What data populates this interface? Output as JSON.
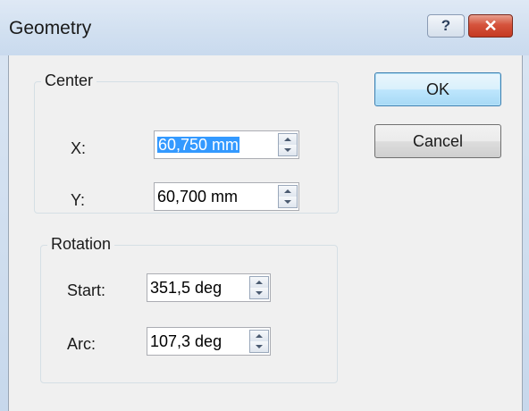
{
  "window": {
    "title": "Geometry",
    "help_label": "?",
    "close_label": "✕"
  },
  "center": {
    "legend": "Center",
    "x_label": "X:",
    "x_value": "60,750 mm",
    "y_label": "Y:",
    "y_value": "60,700 mm"
  },
  "rotation": {
    "legend": "Rotation",
    "start_label": "Start:",
    "start_value": "351,5 deg",
    "arc_label": "Arc:",
    "arc_value": "107,3 deg"
  },
  "buttons": {
    "ok_label": "OK",
    "cancel_label": "Cancel"
  },
  "icons": {
    "help": "help-icon",
    "close": "close-icon",
    "spin_up": "arrow-up-icon",
    "spin_down": "arrow-down-icon"
  },
  "colors": {
    "selection": "#3399ff",
    "close_button": "#c53a22",
    "default_button_border": "#3c7fb1"
  }
}
